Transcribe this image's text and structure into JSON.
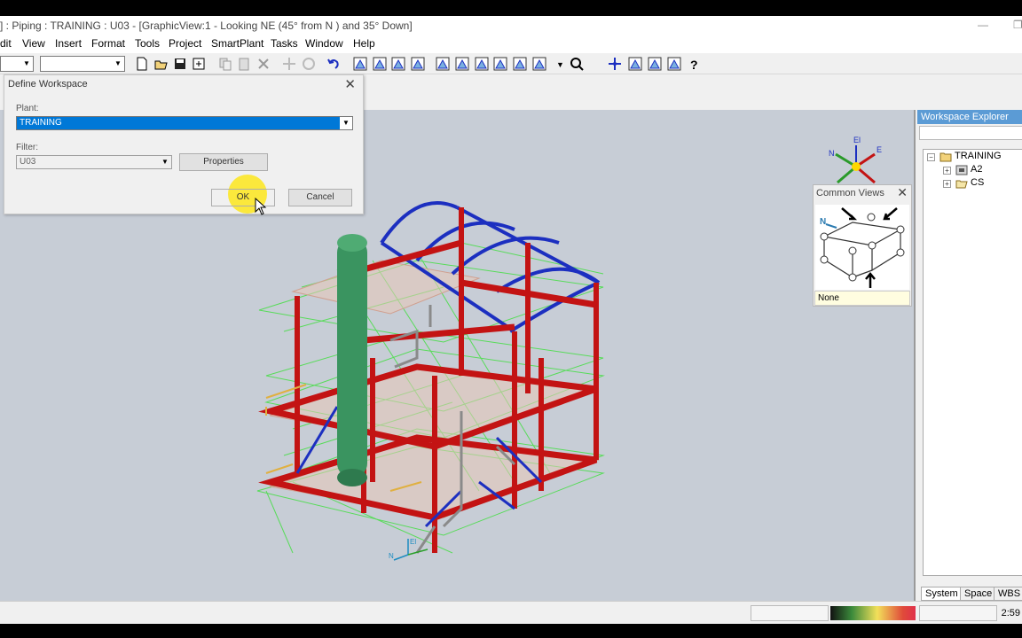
{
  "window": {
    "title": "] : Piping : TRAINING : U03 - [GraphicView:1 - Looking NE (45° from N ) and 35° Down]",
    "minimize_glyph": "—",
    "restore_glyph": "❐"
  },
  "menu": {
    "items": [
      "dit",
      "View",
      "Insert",
      "Format",
      "Tools",
      "Project",
      "SmartPlant",
      "Tasks",
      "Window",
      "Help"
    ]
  },
  "toolbar": {
    "combo1_value": "",
    "combo2_value": "",
    "icons": [
      "new-icon",
      "open-icon",
      "save-icon",
      "properties-icon",
      "copy-icon",
      "paste-icon",
      "delete-icon",
      "move-icon",
      "rotate-icon",
      "undo-icon",
      "select-icon",
      "edit-icon",
      "modify-icon",
      "measure-icon",
      "view-front-icon",
      "view-back-icon",
      "view-top-icon",
      "view-iso-icon",
      "view-pan-icon",
      "view-zoom-area-icon",
      "view-dropdown-icon",
      "zoom-icon",
      "pan-icon",
      "zoom-window-icon",
      "fit-icon",
      "zoom-extents-icon",
      "help-icon"
    ]
  },
  "dialog": {
    "title": "Define Workspace",
    "close_glyph": "✕",
    "plant_label": "Plant:",
    "plant_value": "TRAINING",
    "filter_label": "Filter:",
    "filter_value": "U03",
    "properties_button": "Properties",
    "ok_button": "OK",
    "cancel_button": "Cancel"
  },
  "compass": {
    "up_label": "El",
    "north_label": "N",
    "east_label": "E"
  },
  "common_views": {
    "title": "Common Views",
    "close_glyph": "✕",
    "north_label": "N",
    "selected_value": "None"
  },
  "workspace_explorer": {
    "title": "Workspace Explorer",
    "tree": [
      {
        "label": "TRAINING",
        "expander": "−",
        "icon": "root-folder-icon"
      },
      {
        "label": "A2",
        "expander": "+",
        "icon": "system-icon"
      },
      {
        "label": "CS",
        "expander": "+",
        "icon": "folder-icon"
      }
    ],
    "tabs": [
      "System",
      "Space",
      "WBS"
    ]
  },
  "view_triad": {
    "up_label": "El",
    "north_label": "N"
  },
  "statusbar": {
    "time": "2:59"
  },
  "colors": {
    "structure_red": "#c31313",
    "arch_blue": "#1c2fc0",
    "grid_green": "#4ddd4d",
    "vessel_green": "#3a9460",
    "highlight_yellow": "#ffe600",
    "selection_blue": "#0078d7"
  }
}
